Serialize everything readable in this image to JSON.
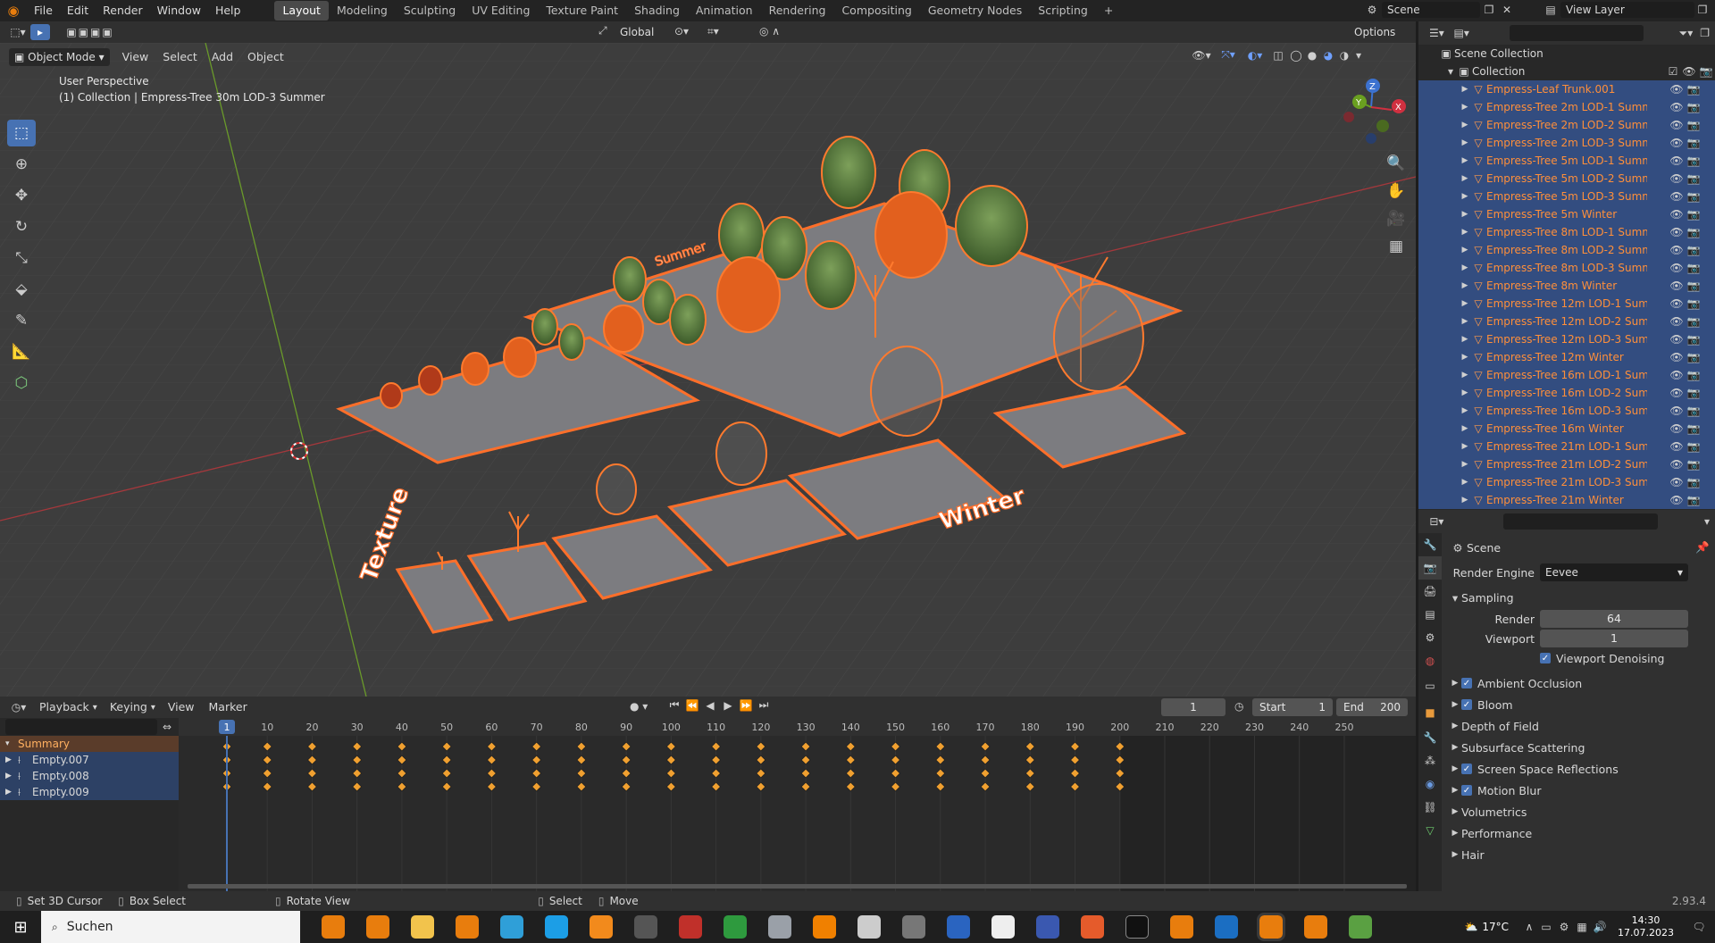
{
  "topbar": {
    "menus": [
      "File",
      "Edit",
      "Render",
      "Window",
      "Help"
    ],
    "workspaces": [
      "Layout",
      "Modeling",
      "Sculpting",
      "UV Editing",
      "Texture Paint",
      "Shading",
      "Animation",
      "Rendering",
      "Compositing",
      "Geometry Nodes",
      "Scripting"
    ],
    "active_workspace": "Layout",
    "add_tab": "+",
    "scene": "Scene",
    "view_layer": "View Layer"
  },
  "viewport_header": {
    "mode": "Object Mode",
    "menus": [
      "View",
      "Select",
      "Add",
      "Object"
    ],
    "orientation": "Global",
    "options": "Options"
  },
  "viewport": {
    "perspective": "User Perspective",
    "collection_info": "(1) Collection | Empress-Tree 30m LOD-3 Summer",
    "labels": {
      "summer": "Summer",
      "winter": "Winter",
      "texture": "Texture"
    },
    "gizmo": {
      "x": "X",
      "y": "Y",
      "z": "Z"
    }
  },
  "outliner": {
    "search_placeholder": "",
    "root": "Scene Collection",
    "collection": "Collection",
    "items": [
      "Empress-Leaf Trunk.001",
      "Empress-Tree 2m LOD-1 Summ",
      "Empress-Tree 2m LOD-2 Summ",
      "Empress-Tree 2m LOD-3 Summ",
      "Empress-Tree 5m LOD-1 Summ",
      "Empress-Tree 5m LOD-2 Summ",
      "Empress-Tree 5m LOD-3 Summ",
      "Empress-Tree 5m Winter",
      "Empress-Tree 8m LOD-1 Summ",
      "Empress-Tree 8m LOD-2 Summ",
      "Empress-Tree 8m LOD-3 Summ",
      "Empress-Tree 8m Winter",
      "Empress-Tree 12m LOD-1 Sum",
      "Empress-Tree 12m LOD-2 Sum",
      "Empress-Tree 12m LOD-3 Sum",
      "Empress-Tree 12m Winter",
      "Empress-Tree 16m LOD-1 Sum",
      "Empress-Tree 16m LOD-2 Sum",
      "Empress-Tree 16m LOD-3 Sum",
      "Empress-Tree 16m Winter",
      "Empress-Tree 21m LOD-1 Sum",
      "Empress-Tree 21m LOD-2 Sum",
      "Empress-Tree 21m LOD-3 Sum",
      "Empress-Tree 21m Winter"
    ]
  },
  "properties": {
    "search_placeholder": "",
    "context": "Scene",
    "render_engine_label": "Render Engine",
    "render_engine": "Eevee",
    "sampling": "Sampling",
    "render_label": "Render",
    "render_value": "64",
    "viewport_label": "Viewport",
    "viewport_value": "1",
    "denoising": "Viewport Denoising",
    "panels": [
      {
        "label": "Ambient Occlusion",
        "checkbox": true
      },
      {
        "label": "Bloom",
        "checkbox": true
      },
      {
        "label": "Depth of Field",
        "checkbox": false
      },
      {
        "label": "Subsurface Scattering",
        "checkbox": false
      },
      {
        "label": "Screen Space Reflections",
        "checkbox": true
      },
      {
        "label": "Motion Blur",
        "checkbox": true
      },
      {
        "label": "Volumetrics",
        "checkbox": false
      },
      {
        "label": "Performance",
        "checkbox": false
      },
      {
        "label": "Hair",
        "checkbox": false
      }
    ]
  },
  "timeline": {
    "menus": [
      "Playback",
      "Keying",
      "View",
      "Marker"
    ],
    "current_frame": "1",
    "start_label": "Start",
    "start": "1",
    "end_label": "End",
    "end": "200",
    "ruler": [
      "1",
      "10",
      "20",
      "30",
      "40",
      "50",
      "60",
      "70",
      "80",
      "90",
      "100",
      "110",
      "120",
      "130",
      "140",
      "150",
      "160",
      "170",
      "180",
      "190",
      "200",
      "210",
      "220",
      "230",
      "240",
      "250"
    ],
    "channels": [
      "Summary",
      "Empty.007",
      "Empty.008",
      "Empty.009"
    ]
  },
  "statusbar": {
    "items": [
      "Set 3D Cursor",
      "Box Select",
      "Rotate View",
      "Select",
      "Move"
    ],
    "version": "2.93.4"
  },
  "taskbar": {
    "search": "Suchen",
    "temperature": "17°C",
    "time": "14:30",
    "date": "17.07.2023"
  }
}
